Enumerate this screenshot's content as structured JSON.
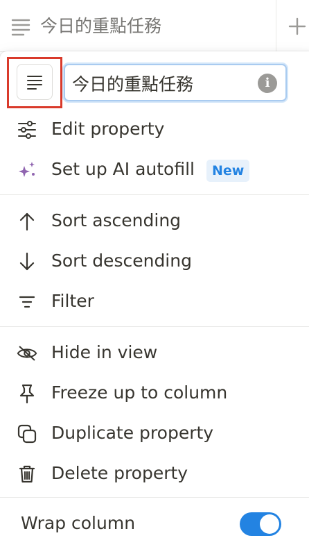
{
  "header": {
    "column_icon": "text-lines-icon",
    "title": "今日的重點任務",
    "add_icon": "plus-icon"
  },
  "menu": {
    "property_icon": "text-lines-icon",
    "name_value": "今日的重點任務",
    "info_icon": "info-icon",
    "info_glyph": "i",
    "items_group1": [
      {
        "label": "Edit property",
        "icon": "sliders-icon"
      },
      {
        "label": "Set up AI autofill",
        "icon": "sparkles-icon",
        "badge": "New"
      }
    ],
    "items_group2": [
      {
        "label": "Sort ascending",
        "icon": "arrow-up-icon"
      },
      {
        "label": "Sort descending",
        "icon": "arrow-down-icon"
      },
      {
        "label": "Filter",
        "icon": "filter-icon"
      }
    ],
    "items_group3": [
      {
        "label": "Hide in view",
        "icon": "eye-off-icon"
      },
      {
        "label": "Freeze up to column",
        "icon": "pin-icon"
      },
      {
        "label": "Duplicate property",
        "icon": "duplicate-icon"
      },
      {
        "label": "Delete property",
        "icon": "trash-icon"
      }
    ],
    "wrap_column": {
      "label": "Wrap column",
      "enabled": true
    }
  },
  "colors": {
    "accent": "#2383e2",
    "highlight_box": "#d93a2b",
    "ai_sparkle": "#9065b0",
    "badge_bg": "#e7f1fb"
  }
}
